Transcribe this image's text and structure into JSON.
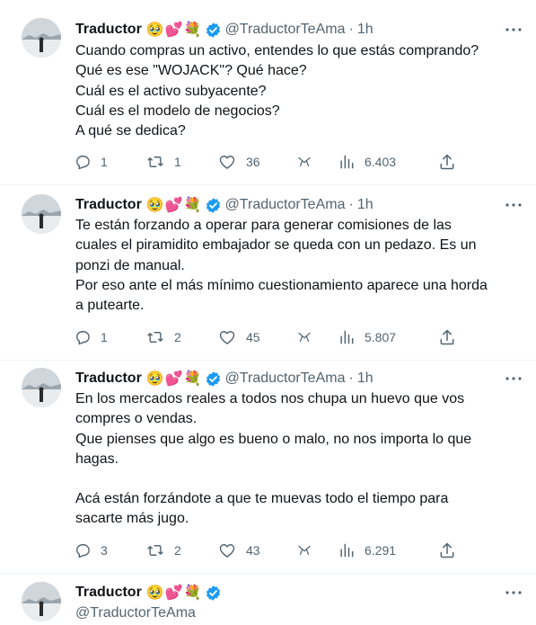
{
  "tweets": [
    {
      "name": "Traductor",
      "emojis": [
        "🥹",
        "💕",
        "💐"
      ],
      "handle": "@TraductorTeAma",
      "time": "1h",
      "lines": [
        "Cuando compras un activo, entendes lo que estás comprando?",
        "Qué es ese \"WOJACK\"? Qué hace?",
        "Cuál es el activo subyacente?",
        "Cuál es el modelo de negocios?",
        "A qué se dedica?"
      ],
      "replies": "1",
      "retweets": "1",
      "likes": "36",
      "views": "6.403"
    },
    {
      "name": "Traductor",
      "emojis": [
        "🥹",
        "💕",
        "💐"
      ],
      "handle": "@TraductorTeAma",
      "time": "1h",
      "lines": [
        "Te están forzando a operar para generar comisiones de las",
        "cuales el piramidito embajador se queda con un pedazo. Es un",
        "ponzi de manual.",
        "Por eso ante el más mínimo cuestionamiento aparece una horda",
        "a putearte."
      ],
      "replies": "1",
      "retweets": "2",
      "likes": "45",
      "views": "5.807"
    },
    {
      "name": "Traductor",
      "emojis": [
        "🥹",
        "💕",
        "💐"
      ],
      "handle": "@TraductorTeAma",
      "time": "1h",
      "lines": [
        "En los mercados reales a todos nos chupa un huevo que vos",
        "compres o vendas.",
        "Que pienses que algo es bueno o malo, no nos importa lo que",
        "hagas.",
        "",
        "Acá están forzándote a que te muevas todo el tiempo para",
        "sacarte más jugo."
      ],
      "replies": "3",
      "retweets": "2",
      "likes": "43",
      "views": "6.291"
    }
  ],
  "last": {
    "name": "Traductor",
    "emojis": [
      "🥹",
      "💕",
      "💐"
    ],
    "handle": "@TraductorTeAma"
  },
  "colors": {
    "text": "#0f1419",
    "muted": "#536471",
    "verified": "#1d9bf0",
    "divider": "#eff3f4"
  }
}
